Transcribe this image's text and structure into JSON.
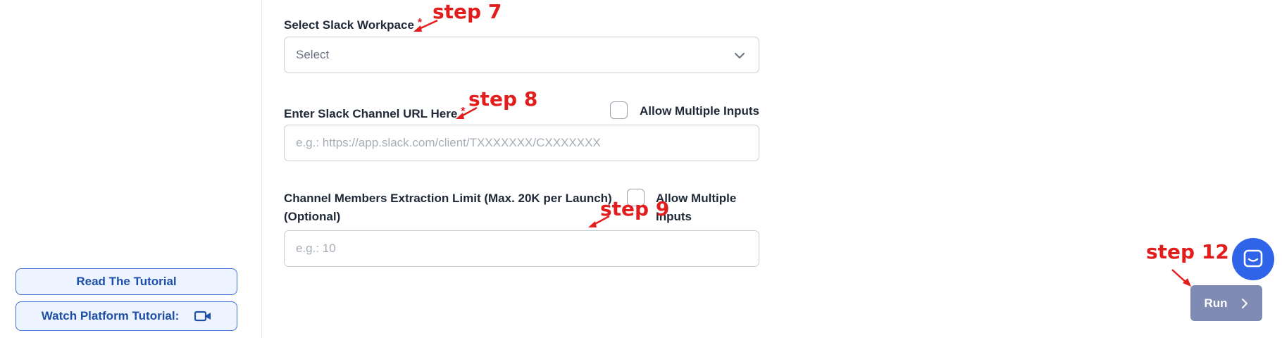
{
  "sidebar": {
    "tutorial_label": "Read The Tutorial",
    "watch_label": "Watch Platform Tutorial:"
  },
  "form": {
    "workspace": {
      "label": "Select Slack Workpace",
      "required_mark": "*",
      "value": "Select"
    },
    "channel_url": {
      "label": "Enter Slack Channel URL Here",
      "required_mark": "*",
      "placeholder": "e.g.: https://app.slack.com/client/TXXXXXXX/CXXXXXXX",
      "allow_multiple_label": "Allow Multiple Inputs"
    },
    "extraction_limit": {
      "label_line1": "Channel Members Extraction Limit (Max. 20K per Launch)",
      "label_line2": "(Optional)",
      "placeholder": "e.g.: 10",
      "allow_multiple_line1": "Allow Multiple",
      "allow_multiple_line2": "Inputs"
    }
  },
  "annotations": {
    "step7": "step 7",
    "step8": "step 8",
    "step9": "step 9",
    "step12": "step 12"
  },
  "actions": {
    "run_label": "Run"
  },
  "colors": {
    "accent": "#2f63e8",
    "annotation": "#e11d1d",
    "run_button": "#7f8bb2"
  },
  "icons": {
    "video": "video-camera-icon",
    "chevron": "chevron-down-icon",
    "run_chevron": "chevron-right-icon",
    "chat": "chat-bubble-icon"
  }
}
